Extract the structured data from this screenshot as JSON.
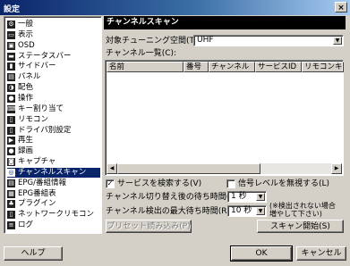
{
  "window": {
    "title": "設定",
    "close_glyph": "×"
  },
  "sidebar": {
    "items": [
      {
        "label": "一般",
        "icon": "general-icon",
        "glyph": "⚙"
      },
      {
        "label": "表示",
        "icon": "display-icon",
        "glyph": "▭"
      },
      {
        "label": "OSD",
        "icon": "osd-icon",
        "glyph": "▣"
      },
      {
        "label": "ステータスバー",
        "icon": "statusbar-icon",
        "glyph": "▬"
      },
      {
        "label": "サイドバー",
        "icon": "sidebar-icon",
        "glyph": "▮"
      },
      {
        "label": "パネル",
        "icon": "panel-icon",
        "glyph": "▤"
      },
      {
        "label": "配色",
        "icon": "palette-icon",
        "glyph": "◑"
      },
      {
        "label": "操作",
        "icon": "mouse-icon",
        "glyph": "●"
      },
      {
        "label": "キー割り当て",
        "icon": "keyboard-icon",
        "glyph": "⌨"
      },
      {
        "label": "リモコン",
        "icon": "remote-icon",
        "glyph": "▯"
      },
      {
        "label": "ドライバ別設定",
        "icon": "driver-icon",
        "glyph": "▯"
      },
      {
        "label": "再生",
        "icon": "play-icon",
        "glyph": "▶"
      },
      {
        "label": "録画",
        "icon": "record-icon",
        "glyph": "●"
      },
      {
        "label": "キャプチャ",
        "icon": "camera-icon",
        "glyph": "◙"
      },
      {
        "label": "チャンネルスキャン",
        "icon": "scan-icon",
        "glyph": "◎",
        "selected": true
      },
      {
        "label": "EPG/番組情報",
        "icon": "epg-icon",
        "glyph": "▤"
      },
      {
        "label": "EPG番組表",
        "icon": "epg-table-icon",
        "glyph": "▦"
      },
      {
        "label": "プラグイン",
        "icon": "plugin-icon",
        "glyph": "♣"
      },
      {
        "label": "ネットワークリモコン",
        "icon": "network-remote-icon",
        "glyph": "▯"
      },
      {
        "label": "ログ",
        "icon": "log-icon",
        "glyph": "≡"
      }
    ]
  },
  "panel": {
    "header": "チャンネルスキャン",
    "space_label": "対象チューニング空間(T):",
    "space_value": "UHF",
    "list_label": "チャンネル一覧(C):",
    "columns": [
      "名前",
      "番号",
      "チャンネル",
      "サービスID",
      "リモコンキー"
    ],
    "scan_service_label": "サービスを検索する(V)",
    "scan_service_checked": true,
    "scan_service_mark": "✓",
    "ignore_signal_label": "信号レベルを無視する(L)",
    "ignore_signal_checked": false,
    "wait_label": "チャンネル切り替え後の待ち時間(W):",
    "wait_value": "1 秒",
    "max_wait_label": "チャンネル検出の最大待ち時間(R):",
    "max_wait_value": "10 秒",
    "note_line1": "(※検出されない場合",
    "note_line2": "増やして下さい)",
    "preset_button": "プリセット読み込み(P)",
    "scan_button": "スキャン開始(S)"
  },
  "footer": {
    "help": "ヘルプ",
    "ok": "OK",
    "cancel": "キャンセル"
  },
  "scroll": {
    "left": "◀",
    "right": "▶",
    "down": "▼"
  },
  "colors": {
    "selection": "#0a246a",
    "face": "#d4d0c8"
  }
}
